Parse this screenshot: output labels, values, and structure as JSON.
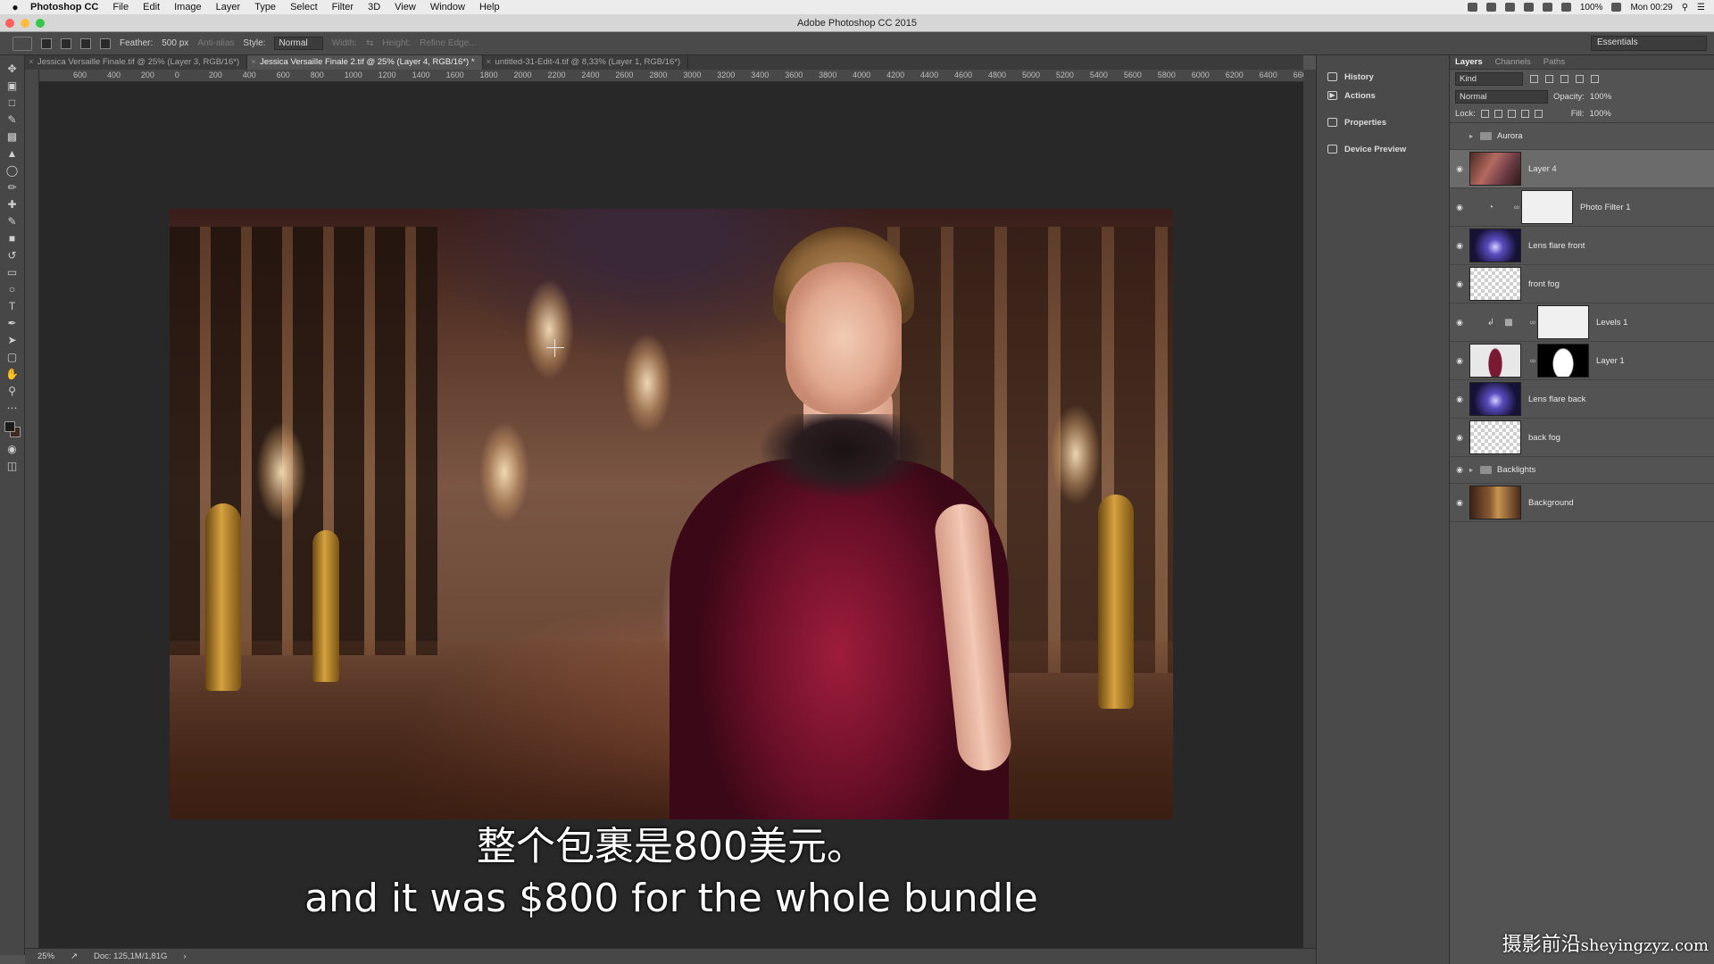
{
  "menubar": {
    "app": "Photoshop CC",
    "items": [
      "File",
      "Edit",
      "Image",
      "Layer",
      "Type",
      "Select",
      "Filter",
      "3D",
      "View",
      "Window",
      "Help"
    ],
    "battery": "100%",
    "clock": "Mon 00:29"
  },
  "window": {
    "title": "Adobe Photoshop CC 2015"
  },
  "options": {
    "feather_label": "Feather:",
    "feather_value": "500 px",
    "antialias": "Anti-alias",
    "style_label": "Style:",
    "style_value": "Normal",
    "width_label": "Width:",
    "height_label": "Height:",
    "refine_edge": "Refine Edge...",
    "workspace": "Essentials"
  },
  "tabs": [
    {
      "label": "Jessica Versaille Finale.tif @ 25% (Layer 3, RGB/16*)",
      "active": false
    },
    {
      "label": "Jessica Versaille Finale 2.tif @ 25% (Layer 4, RGB/16*) *",
      "active": true
    },
    {
      "label": "untitled-31-Edit-4.tif @ 8,33% (Layer 1, RGB/16*)",
      "active": false
    }
  ],
  "ruler_marks": [
    "600",
    "400",
    "200",
    "0",
    "200",
    "400",
    "600",
    "800",
    "1000",
    "1200",
    "1400",
    "1600",
    "1800",
    "2000",
    "2200",
    "2400",
    "2600",
    "2800",
    "3000",
    "3200",
    "3400",
    "3600",
    "3800",
    "4000",
    "4200",
    "4400",
    "4600",
    "4800",
    "5000",
    "5200",
    "5400",
    "5600",
    "5800",
    "6000",
    "6200",
    "6400",
    "6600"
  ],
  "status": {
    "zoom": "25%",
    "doc": "Doc: 125,1M/1,81G"
  },
  "subtitles": {
    "zh": "整个包裹是800美元。",
    "en": "and it was $800 for the whole bundle"
  },
  "dock": {
    "history": "History",
    "actions": "Actions",
    "properties": "Properties",
    "device_preview": "Device Preview"
  },
  "layers_panel": {
    "tabs": [
      "Layers",
      "Channels",
      "Paths"
    ],
    "filter": "Kind",
    "blend_mode": "Normal",
    "opacity_label": "Opacity:",
    "opacity_value": "100%",
    "lock_label": "Lock:",
    "fill_label": "Fill:",
    "fill_value": "100%",
    "layers": [
      {
        "name": "Aurora",
        "kind": "group"
      },
      {
        "name": "Layer 4",
        "kind": "photo",
        "selected": true
      },
      {
        "name": "Photo Filter 1",
        "kind": "adjustment"
      },
      {
        "name": "Lens flare front",
        "kind": "flare"
      },
      {
        "name": "front fog",
        "kind": "check"
      },
      {
        "name": "Levels 1",
        "kind": "levels"
      },
      {
        "name": "Layer 1",
        "kind": "masked"
      },
      {
        "name": "Lens flare back",
        "kind": "flare"
      },
      {
        "name": "back fog",
        "kind": "check"
      },
      {
        "name": "Backlights",
        "kind": "group"
      },
      {
        "name": "Background",
        "kind": "bg"
      }
    ]
  },
  "watermark": {
    "cn": "摄影前沿",
    "site": "sheyingzyz.com"
  }
}
